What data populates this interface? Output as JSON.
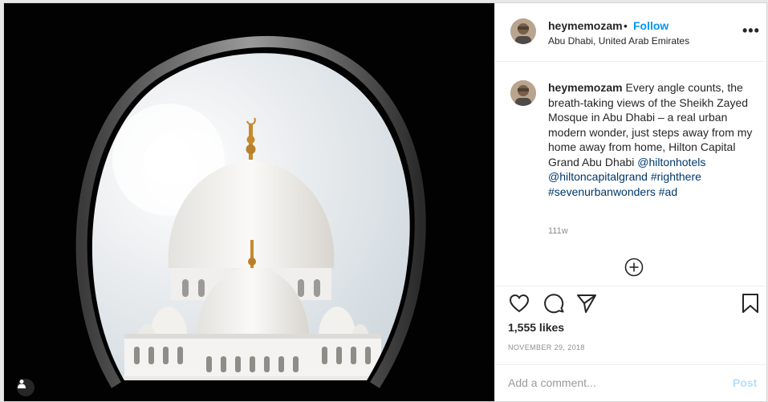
{
  "post": {
    "username": "heymemozam",
    "separator": "•",
    "follow_label": "Follow",
    "location": "Abu Dhabi, United Arab Emirates",
    "more_label": "•••",
    "caption_text": "Every angle counts, the breath-taking views of the Sheikh Zayed Mosque in Abu Dhabi – a real urban modern wonder, just steps away from my home away from home, Hilton Capital Grand Abu Dhabi",
    "mention_1": "@hiltonhotels",
    "mention_2": "@hiltoncapitalgrand",
    "hashtag_1": "#righthere",
    "hashtag_2": "#sevenurbanwonders",
    "hashtag_3": "#ad",
    "age": "111w",
    "likes": "1,555 likes",
    "date": "NOVEMBER 29, 2018"
  },
  "comment": {
    "placeholder": "Add a comment...",
    "post_label": "Post"
  },
  "icons": {
    "like": "heart-icon",
    "comment": "comment-icon",
    "share": "paper-plane-icon",
    "save": "bookmark-icon",
    "load_more": "plus-circle-icon",
    "user_tag": "person-icon"
  },
  "colors": {
    "link": "#0095f6",
    "hashtag": "#00376b",
    "muted": "#8e8e8e",
    "post_disabled": "#b2dffc"
  }
}
